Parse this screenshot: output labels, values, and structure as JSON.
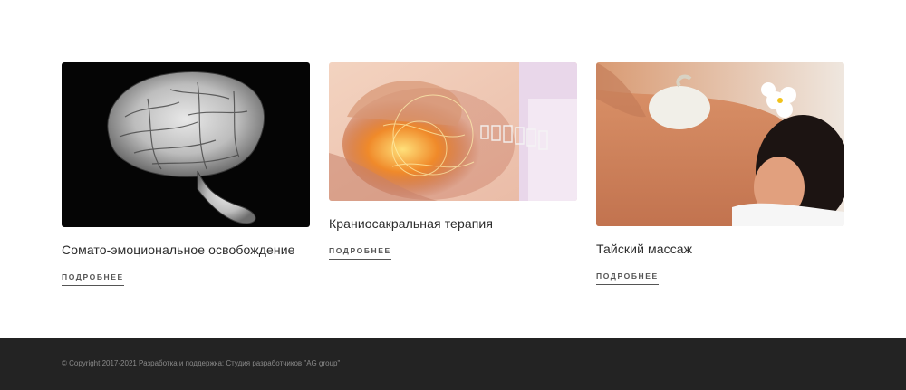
{
  "services": [
    {
      "title": "Сомато-эмоциональное освобождение",
      "link_label": "ПОДРОБНЕЕ",
      "image": "brain-of-hands-photo"
    },
    {
      "title": "Краниосакральная терапия",
      "link_label": "ПОДРОБНЕЕ",
      "image": "craniosacral-therapy-photo"
    },
    {
      "title": "Тайский массаж",
      "link_label": "ПОДРОБНЕЕ",
      "image": "thai-massage-photo"
    }
  ],
  "footer": {
    "copyright": "© Copyright 2017-2021 Разработка и поддержка: Студия разработчиков \"AG group\""
  },
  "colors": {
    "footer_bg": "#232323",
    "footer_text": "#8a8a8a",
    "link_color": "#555555"
  }
}
